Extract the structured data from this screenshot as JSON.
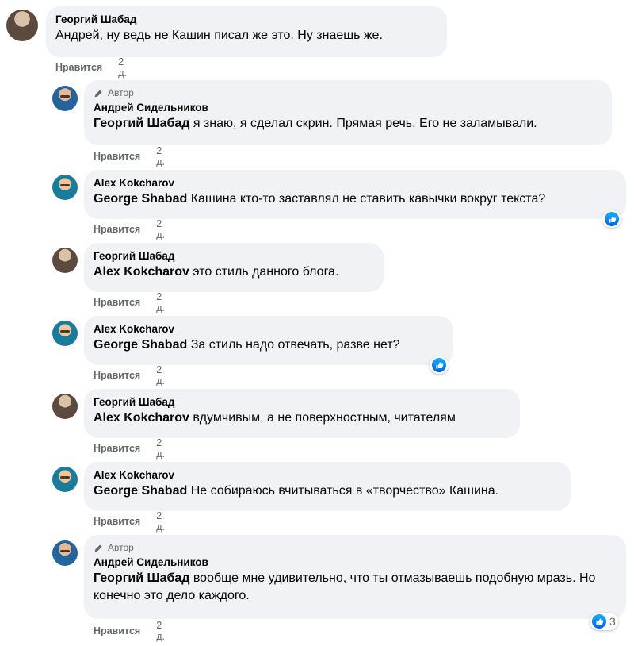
{
  "like_label": "Нравится",
  "age": "2 д.",
  "author_badge": "Автор",
  "comments": [
    {
      "name": "Георгий Шабад",
      "mention": "",
      "text": "Андрей, ну ведь не Кашин писал же это. Ну знаешь же."
    },
    {
      "name": "Андрей Сидельников",
      "mention": "Георгий Шабад",
      "text": " я знаю, я сделал скрин. Прямая речь. Его не заламывали."
    },
    {
      "name": "Alex Kokcharov",
      "mention": "George Shabad",
      "text": " Кашина кто-то заставлял не ставить кавычки вокруг текста?"
    },
    {
      "name": "Георгий Шабад",
      "mention": "Alex Kokcharov",
      "text": " это стиль данного блога."
    },
    {
      "name": "Alex Kokcharov",
      "mention": "George Shabad",
      "text": " За стиль надо отвечать, разве нет?"
    },
    {
      "name": "Георгий Шабад",
      "mention": "Alex Kokcharov",
      "text": " вдумчивым, а не поверхностным, читателям"
    },
    {
      "name": "Alex Kokcharov",
      "mention": "George Shabad",
      "text": " Не собираюсь вчитываться в «творчество» Кашина."
    },
    {
      "name": "Андрей Сидельников",
      "mention": "Георгий Шабад",
      "text": " вообще мне удивительно, что ты отмазываешь подобную мразь. Но конечно это дело каждого."
    }
  ],
  "reaction_count_last": "3",
  "icons": {
    "author": "pen-icon",
    "like": "thumbs-up-icon"
  },
  "colors": {
    "bubble": "#f0f2f5",
    "meta": "#65676b",
    "like_blue": "#1877f2"
  }
}
